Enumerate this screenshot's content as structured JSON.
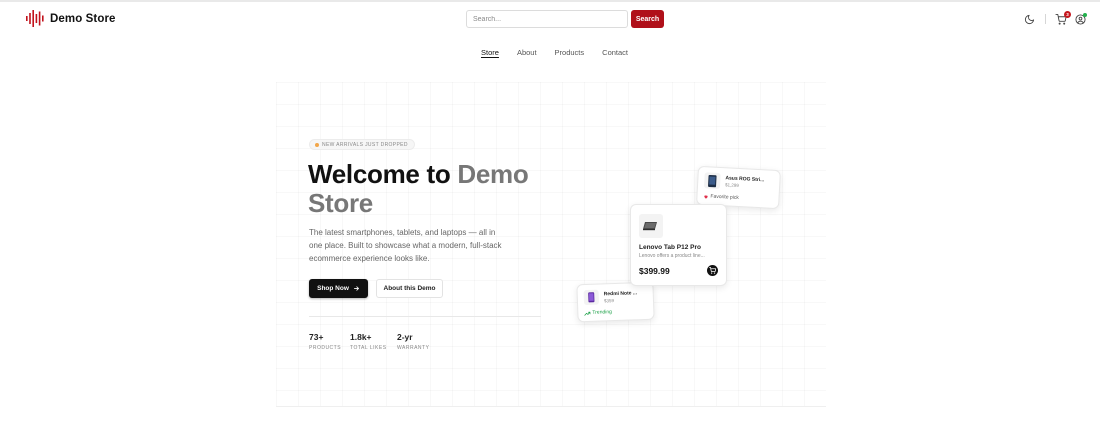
{
  "brand": {
    "name": "Demo Store",
    "logo_icon": "soundwave-logo-icon",
    "accent": "#b0101a"
  },
  "search": {
    "placeholder": "Search...",
    "value": "",
    "button_label": "Search"
  },
  "header_icons": {
    "theme_toggle": "moon-icon",
    "cart": {
      "icon": "cart-icon",
      "count": "3"
    },
    "account": {
      "icon": "user-icon",
      "status_color": "#22b14c"
    }
  },
  "nav": {
    "items": [
      {
        "label": "Store",
        "active": true
      },
      {
        "label": "About",
        "active": false
      },
      {
        "label": "Products",
        "active": false
      },
      {
        "label": "Contact",
        "active": false
      }
    ]
  },
  "hero": {
    "badge": "NEW ARRIVALS JUST DROPPED",
    "title_main": "Welcome to ",
    "title_accent": "Demo Store",
    "description": "The latest smartphones, tablets, and laptops — all in one place. Built to showcase what a modern, full-stack ecommerce experience looks like.",
    "primary_button": "Shop Now",
    "secondary_button": "About this Demo",
    "stats": [
      {
        "value": "73+",
        "label": "PRODUCTS"
      },
      {
        "value": "1.8k+",
        "label": "TOTAL LIKES"
      },
      {
        "value": "2-yr",
        "label": "WARRANTY"
      }
    ]
  },
  "cards": {
    "featured": {
      "name": "Lenovo Tab P12 Pro",
      "description": "Lenovo offers a product line...",
      "price": "$399.99",
      "icon": "tablet-icon"
    },
    "asus": {
      "name": "Asus ROG Stri...",
      "price": "$1,299",
      "tag": "Favorite pick",
      "tag_icon": "heart-icon",
      "tag_color": "#e0314c"
    },
    "redmi": {
      "name": "Redmi Note ...",
      "price": "$359",
      "tag": "Trending",
      "tag_icon": "trending-up-icon",
      "tag_color": "#1fa24a"
    }
  }
}
